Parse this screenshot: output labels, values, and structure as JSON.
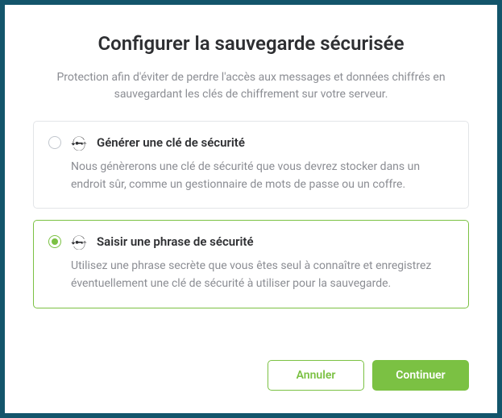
{
  "title": "Configurer la sauvegarde sécurisée",
  "subtitle": "Protection afin d'éviter de perdre l'accès aux messages et données chiffrés en sauvegardant les clés de chiffrement sur votre serveur.",
  "options": [
    {
      "title": "Générer une clé de sécurité",
      "description": "Nous génèrerons une clé de sécurité que vous devrez stocker dans un endroit sûr, comme un gestionnaire de mots de passe ou un coffre.",
      "selected": false
    },
    {
      "title": "Saisir une phrase de sécurité",
      "description": "Utilisez une phrase secrète que vous êtes seul à connaître et enregistrez éventuellement une clé de sécurité à utiliser pour la sauvegarde.",
      "selected": true
    }
  ],
  "buttons": {
    "cancel": "Annuler",
    "continue": "Continuer"
  },
  "colors": {
    "accent": "#7bc143"
  }
}
